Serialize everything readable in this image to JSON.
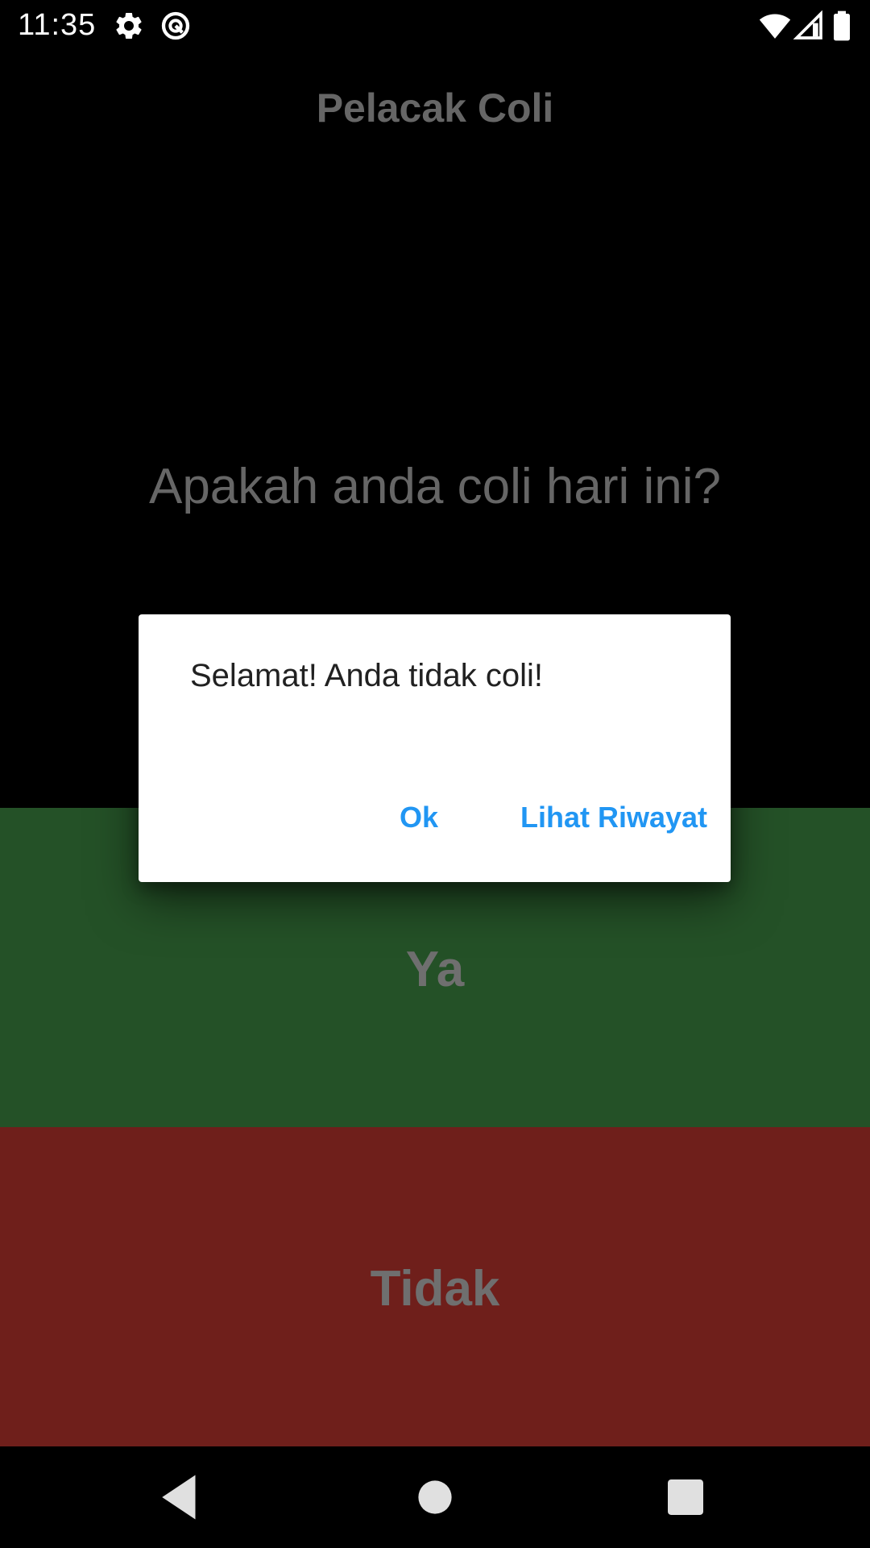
{
  "status_bar": {
    "time": "11:35",
    "icons": [
      "settings-icon",
      "do-not-disturb-icon",
      "wifi-icon",
      "cellular-signal-icon",
      "battery-icon"
    ]
  },
  "app": {
    "title": "Pelacak Coli",
    "question": "Apakah anda coli hari ini?",
    "yes_label": "Ya",
    "no_label": "Tidak",
    "colors": {
      "yes_background": "#245127",
      "no_background": "#6f1f1b",
      "dim_text": "#666666"
    }
  },
  "dialog": {
    "message": "Selamat! Anda tidak coli!",
    "ok_label": "Ok",
    "history_label": "Lihat Riwayat",
    "accent": "#2196F3"
  },
  "nav_bar": {
    "icons": [
      "back-icon",
      "home-icon",
      "recents-icon"
    ]
  }
}
